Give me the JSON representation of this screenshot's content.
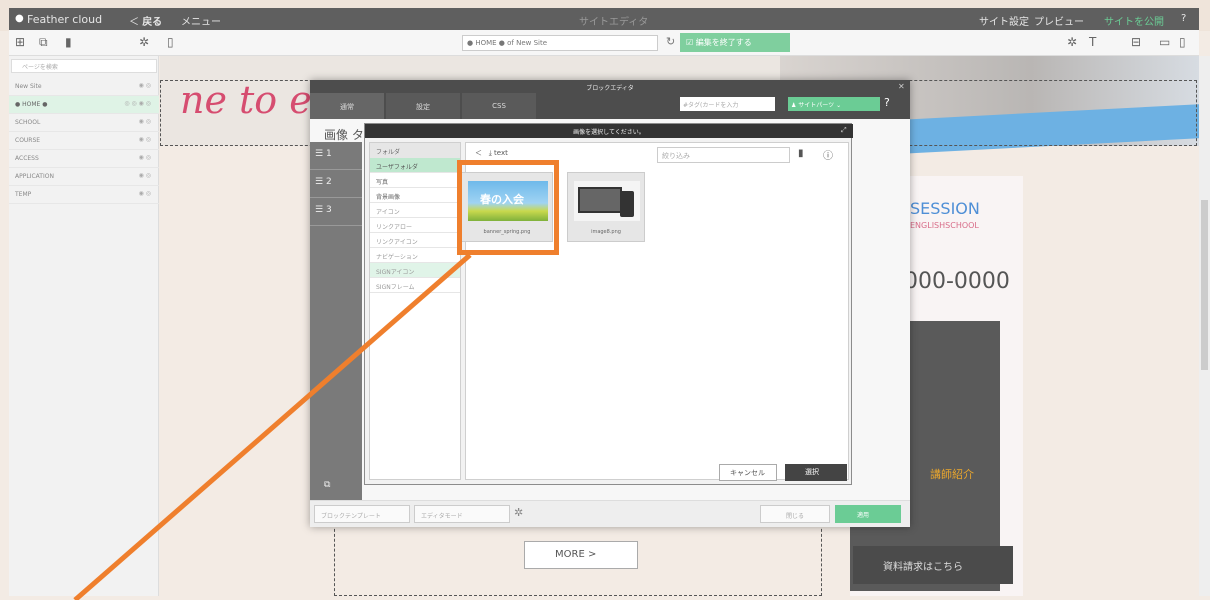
{
  "app": {
    "brand": "Feather cloud",
    "back": "戻る",
    "menu": "メニュー",
    "center_title": "サイトエディタ",
    "site_settings": "サイト設定",
    "preview": "プレビュー",
    "publish": "サイトを公開"
  },
  "toolbar": {
    "url": "● HOME ● of New Site",
    "edit_end": "編集を終了する"
  },
  "sidebar": {
    "search_placeholder": "ページを検索",
    "items": [
      "New Site",
      "● HOME ●",
      "SCHOOL",
      "COURSE",
      "ACCESS",
      "APPLICATION",
      "TEMP"
    ]
  },
  "page": {
    "script_text": "ne to e",
    "session": "SESSION",
    "english_school": "ENGLISHSCHOOL",
    "phone": "000-0000",
    "teacher": "講師紹介",
    "doc_request": "資料請求はこちら",
    "more": "MORE  >"
  },
  "block_editor": {
    "title": "ブロックエディタ",
    "tabs": [
      "通常",
      "設定",
      "CSS"
    ],
    "tag_placeholder": "#タグ(カードを入力",
    "site_parts": "サイトパーツ",
    "image_label": "画像 タ",
    "rows": [
      "1",
      "2",
      "3"
    ],
    "bottom": {
      "template": "ブロックテンプレート",
      "editor_mode": "エディタモード",
      "close": "閉じる",
      "apply": "適用"
    }
  },
  "image_dialog": {
    "title": "画像を選択してください。",
    "folders": [
      "フォルダ",
      "ユーザフォルダ",
      "写真",
      "背景画像",
      "アイコン",
      "リンクアロー",
      "リンクアイコン",
      "ナビゲーション",
      "SIGNアイコン",
      "SIGNフレーム"
    ],
    "path": "text",
    "filter_placeholder": "絞り込み",
    "files": [
      {
        "name": "banner_spring.png",
        "caption": "春の入会"
      },
      {
        "name": "image8.png"
      }
    ],
    "cancel": "キャンセル",
    "select": "選択"
  },
  "colors": {
    "accent_green": "#6bcc95",
    "highlight": "#ef7f2d"
  }
}
